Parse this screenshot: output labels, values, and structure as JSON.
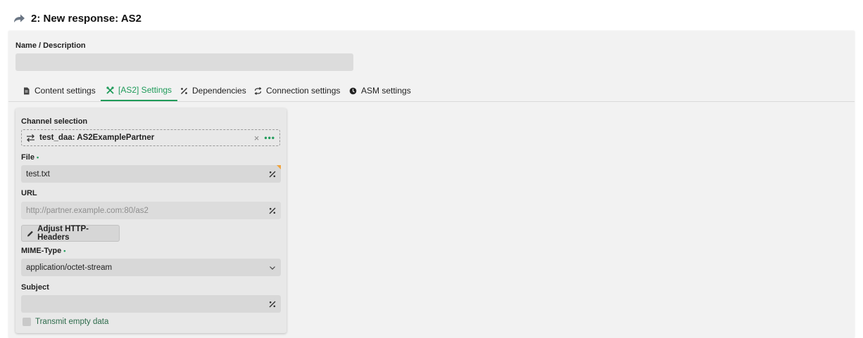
{
  "header": {
    "title": "2: New response: AS2",
    "icon": "forward-arrow-icon"
  },
  "form": {
    "name_label": "Name / Description",
    "name_value": ""
  },
  "tabs": [
    {
      "label": "Content settings",
      "icon": "document-icon",
      "active": false
    },
    {
      "label": "[AS2] Settings",
      "icon": "tools-icon",
      "active": true
    },
    {
      "label": "Dependencies",
      "icon": "percent-icon",
      "active": false
    },
    {
      "label": "Connection settings",
      "icon": "refresh-icon",
      "active": false
    },
    {
      "label": "ASM settings",
      "icon": "asm-icon",
      "active": false
    }
  ],
  "as2": {
    "channel_label": "Channel selection",
    "channel_value": "test_daa:  AS2ExamplePartner",
    "file_label": "File",
    "file_value": "test.txt",
    "url_label": "URL",
    "url_placeholder": "http://partner.example.com:80/as2",
    "adjust_button": "Adjust HTTP-Headers",
    "mime_label": "MIME-Type",
    "mime_value": "application/octet-stream",
    "subject_label": "Subject",
    "subject_value": "",
    "transmit_label": "Transmit empty data",
    "transmit_checked": false
  },
  "colors": {
    "accent": "#1f9b5a",
    "modified": "#f0a33c"
  }
}
